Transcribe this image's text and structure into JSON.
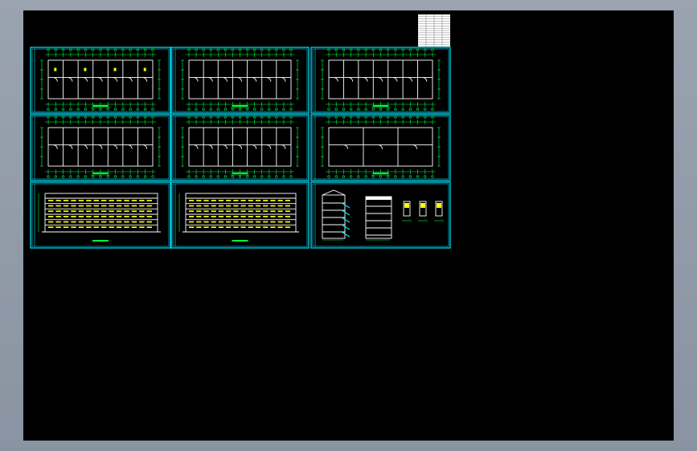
{
  "viewport": {
    "background": "#000000",
    "frame_color": "#9aa3b0",
    "line_color": "#00e5ff",
    "dim_color": "#00ff40",
    "highlight_color": "#ffff00"
  },
  "sheets": [
    {
      "type": "floor-plan"
    },
    {
      "type": "floor-plan"
    },
    {
      "type": "floor-plan"
    },
    {
      "type": "floor-plan"
    },
    {
      "type": "floor-plan"
    },
    {
      "type": "roof-plan"
    },
    {
      "type": "elevation"
    },
    {
      "type": "elevation"
    },
    {
      "type": "section"
    }
  ],
  "schedule_table": {
    "rows": 14,
    "cols": 4
  }
}
